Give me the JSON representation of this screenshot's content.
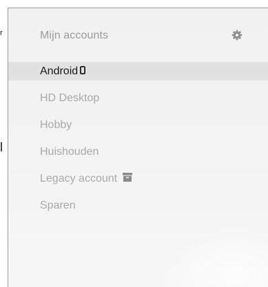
{
  "edge_marks": {
    "top": "r",
    "middle": "l"
  },
  "sidebar": {
    "title": "Mijn accounts",
    "settings_icon": "gear-icon",
    "accounts": [
      {
        "label": "Android",
        "active": true,
        "icon": "mobile-phone-icon"
      },
      {
        "label": "HD Desktop",
        "active": false
      },
      {
        "label": "Hobby",
        "active": false
      },
      {
        "label": "Huishouden",
        "active": false
      },
      {
        "label": "Legacy account",
        "active": false,
        "icon": "archive-icon"
      },
      {
        "label": "Sparen",
        "active": false
      }
    ]
  },
  "colors": {
    "panel_background": "#f1f1f1",
    "active_row_background": "#e1e1e1",
    "active_text": "#1a1a1a",
    "inactive_text": "#a9a9a9",
    "title_text": "#9b9b9b",
    "icon_gray": "#8e8e8e"
  }
}
